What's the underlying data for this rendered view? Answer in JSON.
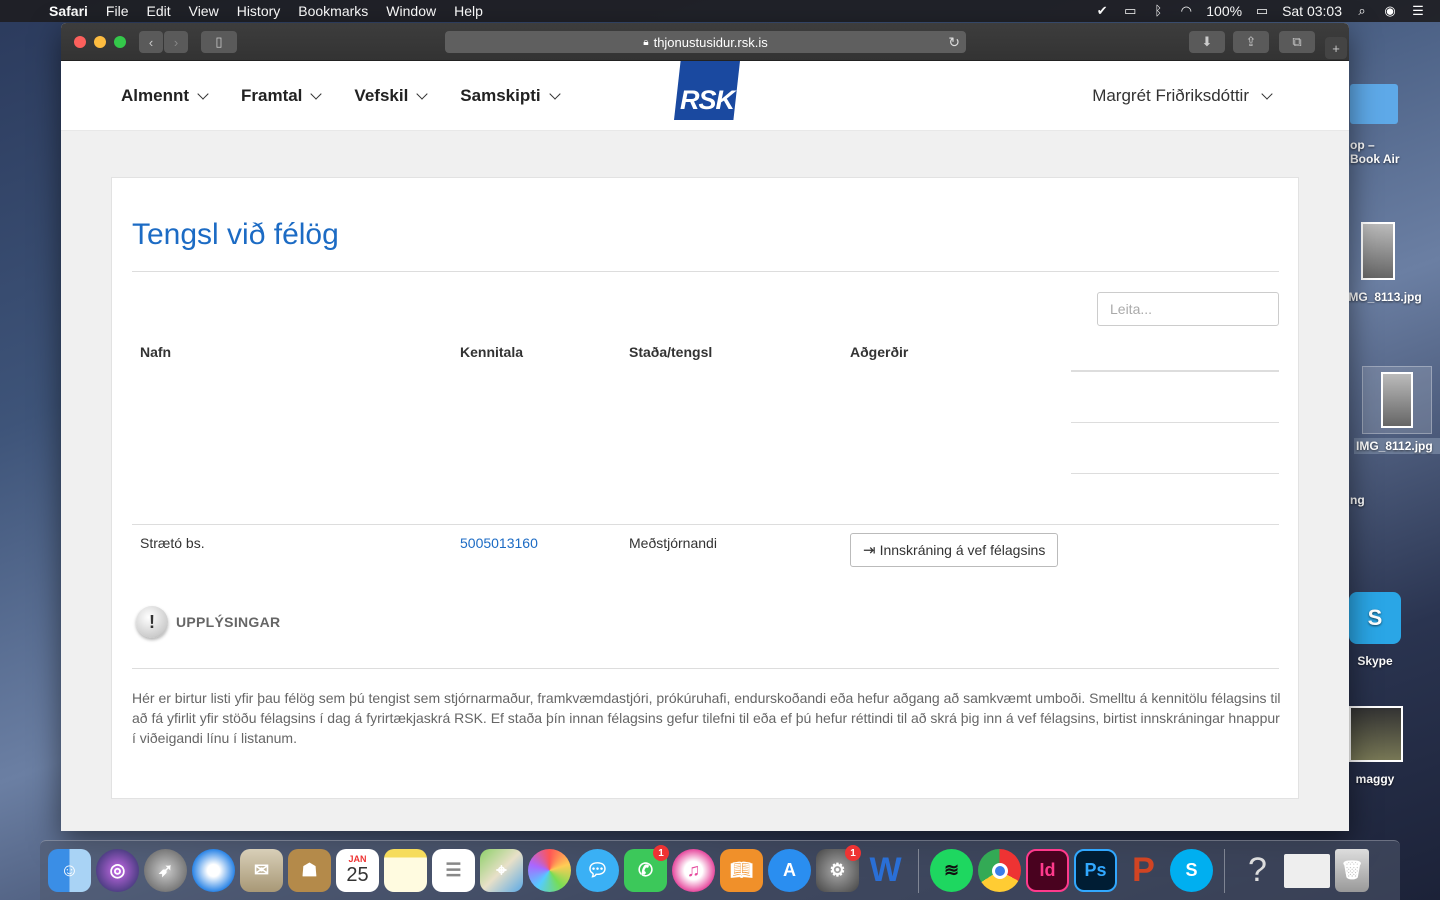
{
  "menubar": {
    "app": "Safari",
    "items": [
      "File",
      "Edit",
      "View",
      "History",
      "Bookmarks",
      "Window",
      "Help"
    ],
    "battery": "100%",
    "clock": "Sat 03:03"
  },
  "desktop": {
    "items": [
      {
        "label": "op –\nBook Air"
      },
      {
        "label": "IMG_8113.jpg"
      },
      {
        "label": "IMG_8112.jpg"
      },
      {
        "label": "ng"
      },
      {
        "label": "Skype"
      },
      {
        "label": "maggy"
      }
    ]
  },
  "browser": {
    "url": "thjonustusidur.rsk.is"
  },
  "site": {
    "nav": [
      "Almennt",
      "Framtal",
      "Vefskil",
      "Samskipti"
    ],
    "logo": "RSK",
    "user": "Margrét Friðriksdóttir"
  },
  "page": {
    "title": "Tengsl við félög",
    "search_placeholder": "Leita...",
    "columns": [
      "Nafn",
      "Kennitala",
      "Staða/tengsl",
      "Aðgerðir"
    ],
    "rows": [
      {
        "name": "Strætó bs.",
        "kennitala": "5005013160",
        "status": "Meðstjórnandi",
        "action": "Innskráning á vef félagsins"
      }
    ],
    "info_title": "UPPLÝSINGAR",
    "info_text": "Hér er birtur listi yfir þau félög sem þú tengist sem stjórnarmaður, framkvæmdastjóri, prókúruhafi, endurskoðandi eða hefur aðgang að samkvæmt umboði. Smelltu á kennitölu félagsins til að fá yfirlit yfir stöðu félagsins í dag á fyrirtækjaskrá RSK. Ef staða þín innan félagsins gefur tilefni til eða ef þú hefur réttindi til að skrá þig inn á vef félagsins, birtist innskráningar hnappur í viðeigandi línu í listanum."
  },
  "dock": {
    "calendar_month": "JAN",
    "calendar_day": "25",
    "facetime_badge": "1",
    "settings_badge": "1"
  }
}
